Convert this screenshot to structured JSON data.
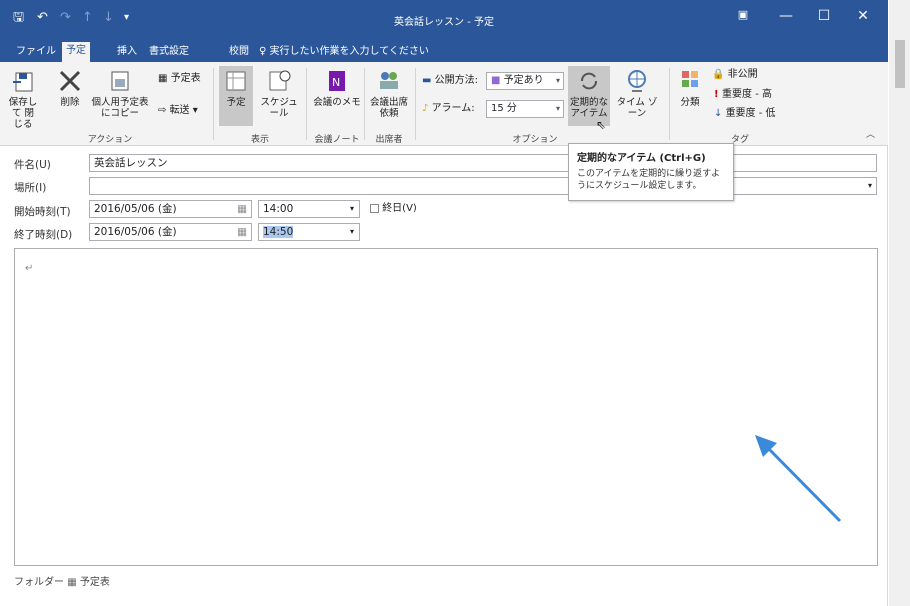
{
  "window": {
    "title": "英会話レッスン - 予定"
  },
  "qat": {
    "save": "🖫",
    "undo": "↶",
    "redo": "↷",
    "up": "↑",
    "down": "↓",
    "more": "▾"
  },
  "controls": {
    "ribbon_display": "▣",
    "minimize": "—",
    "maximize": "☐",
    "close": "✕"
  },
  "tabs": [
    {
      "label": "ファイル"
    },
    {
      "label": "予定"
    },
    {
      "label": "挿入"
    },
    {
      "label": "書式設定"
    },
    {
      "label": "校閲"
    },
    {
      "label": "♀ 実行したい作業を入力してください"
    }
  ],
  "ribbon": {
    "actions": {
      "save_close": "保存して 閉じる",
      "delete": "削除",
      "copy_to": "個人用予定表 にコピー",
      "calendar": "予定表",
      "forward": "転送",
      "group": "アクション"
    },
    "show": {
      "appointment": "予定",
      "schedule": "スケジュール",
      "group": "表示"
    },
    "meeting_notes": {
      "label": "会議のメモ",
      "group": "会議ノート"
    },
    "attendees": {
      "label": "会議出席 依頼",
      "group": "出席者"
    },
    "options": {
      "show_as_label": "公開方法:",
      "show_as_value": "予定あり",
      "alarm_label": "アラーム:",
      "alarm_value": "15 分",
      "recurrence": "定期的な アイテム",
      "timezone": "タイム ゾーン",
      "group": "オプション"
    },
    "tags": {
      "categorize": "分類",
      "private": "非公開",
      "high": "重要度 - 高",
      "low": "重要度 - 低",
      "group": "タグ"
    }
  },
  "tooltip": {
    "title": "定期的なアイテム (Ctrl+G)",
    "body": "このアイテムを定期的に繰り返すようにスケジュール設定します。"
  },
  "form": {
    "subject_label": "件名(U)",
    "subject_value": "英会話レッスン",
    "location_label": "場所(I)",
    "location_value": "",
    "start_label": "開始時刻(T)",
    "start_date": "2016/05/06 (金)",
    "start_time": "14:00",
    "allday_label": "終日(V)",
    "end_label": "終了時刻(D)",
    "end_date": "2016/05/06 (金)",
    "end_time": "14:50"
  },
  "status": {
    "folder_label": "フォルダー",
    "folder_value": "予定表"
  },
  "colors": {
    "accent": "#2b579a",
    "arrow": "#3b8ad9"
  }
}
